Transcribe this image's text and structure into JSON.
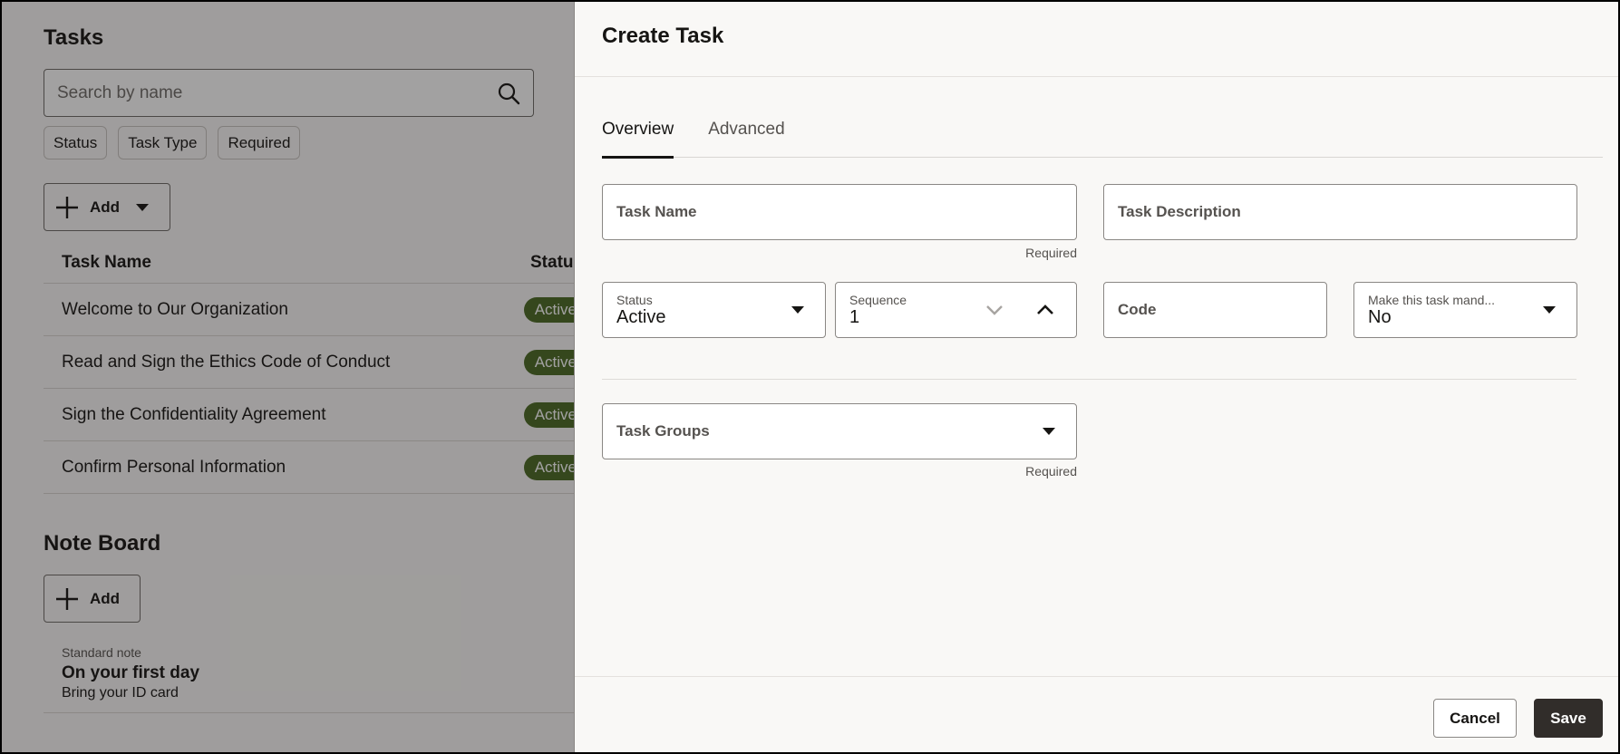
{
  "background_page": {
    "tasks": {
      "title": "Tasks",
      "search": {
        "placeholder": "Search by name",
        "value": ""
      },
      "filters": [
        "Status",
        "Task Type",
        "Required"
      ],
      "add_button": "Add",
      "columns": [
        "Task Name",
        "Status"
      ],
      "rows": [
        {
          "name": "Welcome to Our Organization",
          "status": "Active"
        },
        {
          "name": "Read and Sign the Ethics Code of Conduct",
          "status": "Active"
        },
        {
          "name": "Sign the Confidentiality Agreement",
          "status": "Active"
        },
        {
          "name": "Confirm Personal Information",
          "status": "Active"
        }
      ]
    },
    "note_board": {
      "title": "Note Board",
      "add_button": "Add",
      "notes": [
        {
          "type": "Standard note",
          "title": "On your first day",
          "body": "Bring your ID card"
        }
      ]
    }
  },
  "drawer": {
    "title": "Create Task",
    "tabs": [
      {
        "label": "Overview",
        "active": true
      },
      {
        "label": "Advanced",
        "active": false
      }
    ],
    "fields": {
      "task_name": {
        "label": "Task Name",
        "value": "",
        "help": "Required"
      },
      "task_description": {
        "label": "Task Description",
        "value": ""
      },
      "status": {
        "label": "Status",
        "value": "Active"
      },
      "sequence": {
        "label": "Sequence",
        "value": "1"
      },
      "code": {
        "label": "Code",
        "value": ""
      },
      "mandatory": {
        "label": "Make this task mand...",
        "value": "No"
      },
      "task_groups": {
        "label": "Task Groups",
        "value": "",
        "help": "Required"
      }
    },
    "footer": {
      "cancel_label": "Cancel",
      "save_label": "Save"
    }
  },
  "colors": {
    "status_badge": "#4a6a24",
    "primary_button": "#312d2a",
    "drawer_bg": "#f9f8f6"
  }
}
